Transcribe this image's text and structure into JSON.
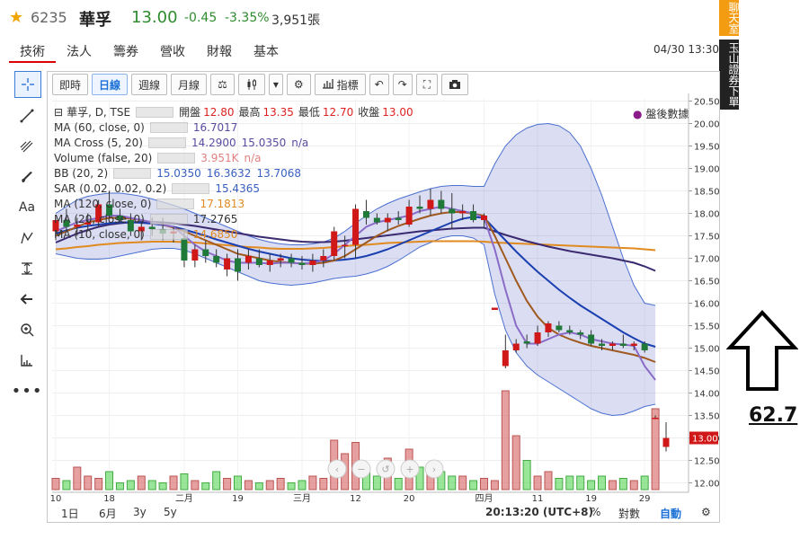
{
  "header": {
    "code": "6235",
    "name": "華孚",
    "price": "13.00",
    "change": "-0.45",
    "change_pct": "-3.35%",
    "volume": "3,951張"
  },
  "tabs": [
    "技術",
    "法人",
    "籌券",
    "營收",
    "財報",
    "基本"
  ],
  "datetime": "04/30 13:30",
  "side": {
    "chat": "聊天室",
    "broker": "玉山證券下單"
  },
  "annotation_value": "62.7",
  "toolbar": [
    "即時",
    "日線",
    "週線",
    "月線"
  ],
  "toolbar_indicator": "指標",
  "legend": {
    "title": "華孚, D, TSE",
    "ohlc": {
      "open_label": "開盤",
      "open": "12.80",
      "high_label": "最高",
      "high": "13.35",
      "low_label": "最低",
      "low": "12.70",
      "close_label": "收盤",
      "close": "13.00"
    },
    "rows": [
      {
        "name": "MA (60, close, 0)",
        "vals": [
          "16.7017"
        ],
        "color": "#5a4aa0"
      },
      {
        "name": "MA Cross (5, 20)",
        "vals": [
          "14.2900",
          "15.0350",
          "n/a"
        ],
        "color": "#5a4aa0"
      },
      {
        "name": "Volume (false, 20)",
        "vals": [
          "3.951K",
          "n/a"
        ],
        "color": "#e08080"
      },
      {
        "name": "BB (20, 2)",
        "vals": [
          "15.0350",
          "16.3632",
          "13.7068"
        ],
        "color": "#3a60c0"
      },
      {
        "name": "SAR (0.02, 0.02, 0.2)",
        "vals": [
          "15.4365"
        ],
        "color": "#3a60c0"
      },
      {
        "name": "MA (120, close, 0)",
        "vals": [
          "17.1813"
        ],
        "color": "#e08a20"
      },
      {
        "name": "MA (20, close, 0)",
        "vals": [
          "17.2765"
        ],
        "color": "#333333"
      },
      {
        "name": "MA (10, close, 0)",
        "vals": [
          "14.6850"
        ],
        "color": "#e08a20"
      }
    ],
    "after_hours": "盤後數據"
  },
  "bottom": {
    "ranges": [
      "1日",
      "6月",
      "3y",
      "5y"
    ],
    "time": "20:13:20 (UTC+8)",
    "pct": "%",
    "log": "對數",
    "auto": "自動"
  },
  "chart_data": {
    "type": "candlestick",
    "title": "華孚, D, TSE",
    "y_ticks": [
      "20.50",
      "20.00",
      "19.50",
      "19.00",
      "18.50",
      "18.00",
      "17.50",
      "17.00",
      "16.50",
      "16.00",
      "15.50",
      "15.00",
      "14.50",
      "14.00",
      "13.50",
      "13.00",
      "12.50",
      "12.00"
    ],
    "ylim": [
      11.85,
      20.55
    ],
    "x_ticks": [
      {
        "label": "10",
        "i": 0
      },
      {
        "label": "18",
        "i": 5
      },
      {
        "label": "二月",
        "i": 12
      },
      {
        "label": "19",
        "i": 17
      },
      {
        "label": "三月",
        "i": 23
      },
      {
        "label": "12",
        "i": 28
      },
      {
        "label": "20",
        "i": 33
      },
      {
        "label": "四月",
        "i": 40
      },
      {
        "label": "11",
        "i": 45
      },
      {
        "label": "19",
        "i": 50
      },
      {
        "label": "29",
        "i": 55
      }
    ],
    "last_price_label": "13.00",
    "candles": [
      {
        "o": 17.6,
        "h": 17.9,
        "l": 17.4,
        "c": 17.85
      },
      {
        "o": 17.85,
        "h": 18.1,
        "l": 17.6,
        "c": 17.7
      },
      {
        "o": 17.7,
        "h": 17.9,
        "l": 17.5,
        "c": 17.75
      },
      {
        "o": 17.75,
        "h": 18.0,
        "l": 17.6,
        "c": 17.8
      },
      {
        "o": 17.8,
        "h": 18.3,
        "l": 17.7,
        "c": 18.2
      },
      {
        "o": 18.2,
        "h": 18.5,
        "l": 17.9,
        "c": 17.95
      },
      {
        "o": 17.95,
        "h": 18.1,
        "l": 17.8,
        "c": 17.85
      },
      {
        "o": 17.85,
        "h": 18.0,
        "l": 17.5,
        "c": 17.6
      },
      {
        "o": 17.6,
        "h": 17.8,
        "l": 17.4,
        "c": 17.7
      },
      {
        "o": 17.7,
        "h": 17.9,
        "l": 17.5,
        "c": 17.65
      },
      {
        "o": 17.65,
        "h": 17.9,
        "l": 17.4,
        "c": 17.55
      },
      {
        "o": 17.55,
        "h": 17.7,
        "l": 17.35,
        "c": 17.6
      },
      {
        "o": 17.45,
        "h": 17.6,
        "l": 16.8,
        "c": 16.95
      },
      {
        "o": 16.95,
        "h": 17.3,
        "l": 16.8,
        "c": 17.2
      },
      {
        "o": 17.2,
        "h": 17.4,
        "l": 16.9,
        "c": 17.05
      },
      {
        "o": 17.05,
        "h": 17.2,
        "l": 16.8,
        "c": 16.9
      },
      {
        "o": 16.75,
        "h": 17.1,
        "l": 16.6,
        "c": 17.0
      },
      {
        "o": 17.0,
        "h": 17.2,
        "l": 16.5,
        "c": 16.7
      },
      {
        "o": 16.9,
        "h": 17.2,
        "l": 16.75,
        "c": 17.05
      },
      {
        "o": 17.0,
        "h": 17.2,
        "l": 16.8,
        "c": 16.85
      },
      {
        "o": 16.85,
        "h": 17.1,
        "l": 16.7,
        "c": 16.95
      },
      {
        "o": 16.95,
        "h": 17.1,
        "l": 16.8,
        "c": 17.0
      },
      {
        "o": 17.0,
        "h": 17.1,
        "l": 16.8,
        "c": 16.9
      },
      {
        "o": 16.9,
        "h": 17.05,
        "l": 16.75,
        "c": 16.85
      },
      {
        "o": 16.85,
        "h": 17.1,
        "l": 16.7,
        "c": 16.95
      },
      {
        "o": 16.95,
        "h": 17.2,
        "l": 16.8,
        "c": 17.05
      },
      {
        "o": 17.05,
        "h": 17.7,
        "l": 16.95,
        "c": 17.6
      },
      {
        "o": 17.3,
        "h": 17.5,
        "l": 17.0,
        "c": 17.3
      },
      {
        "o": 17.3,
        "h": 18.2,
        "l": 17.0,
        "c": 18.1
      },
      {
        "o": 18.05,
        "h": 18.3,
        "l": 17.75,
        "c": 17.9
      },
      {
        "o": 17.9,
        "h": 18.0,
        "l": 17.75,
        "c": 17.8
      },
      {
        "o": 17.8,
        "h": 18.0,
        "l": 17.6,
        "c": 17.9
      },
      {
        "o": 17.9,
        "h": 18.05,
        "l": 17.75,
        "c": 17.85
      },
      {
        "o": 17.75,
        "h": 18.3,
        "l": 17.7,
        "c": 18.15
      },
      {
        "o": 18.15,
        "h": 18.4,
        "l": 18.0,
        "c": 18.1
      },
      {
        "o": 18.1,
        "h": 18.55,
        "l": 17.95,
        "c": 18.3
      },
      {
        "o": 18.3,
        "h": 18.5,
        "l": 18.0,
        "c": 18.1
      },
      {
        "o": 18.1,
        "h": 18.45,
        "l": 17.65,
        "c": 18.0
      },
      {
        "o": 18.0,
        "h": 18.2,
        "l": 17.85,
        "c": 18.05
      },
      {
        "o": 18.05,
        "h": 18.2,
        "l": 17.8,
        "c": 17.85
      },
      {
        "o": 17.85,
        "h": 18.0,
        "l": 17.7,
        "c": 17.95
      },
      {
        "o": 15.85,
        "h": 15.9,
        "l": 15.85,
        "c": 15.9
      },
      {
        "o": 14.6,
        "h": 15.3,
        "l": 14.55,
        "c": 14.95
      },
      {
        "o": 14.95,
        "h": 15.2,
        "l": 14.9,
        "c": 15.1
      },
      {
        "o": 15.15,
        "h": 15.3,
        "l": 15.0,
        "c": 15.1
      },
      {
        "o": 15.1,
        "h": 15.5,
        "l": 15.05,
        "c": 15.35
      },
      {
        "o": 15.35,
        "h": 15.6,
        "l": 15.25,
        "c": 15.55
      },
      {
        "o": 15.5,
        "h": 15.6,
        "l": 15.35,
        "c": 15.4
      },
      {
        "o": 15.4,
        "h": 15.5,
        "l": 15.3,
        "c": 15.35
      },
      {
        "o": 15.35,
        "h": 15.4,
        "l": 15.2,
        "c": 15.3
      },
      {
        "o": 15.3,
        "h": 15.4,
        "l": 15.05,
        "c": 15.1
      },
      {
        "o": 15.1,
        "h": 15.2,
        "l": 14.95,
        "c": 15.05
      },
      {
        "o": 15.05,
        "h": 15.15,
        "l": 14.95,
        "c": 15.1
      },
      {
        "o": 15.1,
        "h": 15.3,
        "l": 15.0,
        "c": 15.05
      },
      {
        "o": 15.05,
        "h": 15.15,
        "l": 14.95,
        "c": 15.1
      },
      {
        "o": 15.1,
        "h": 15.15,
        "l": 14.9,
        "c": 14.95
      },
      {
        "o": 13.45,
        "h": 13.5,
        "l": 13.45,
        "c": 13.45
      },
      {
        "o": 12.8,
        "h": 13.35,
        "l": 12.7,
        "c": 13.0
      }
    ],
    "volumes": [
      0.25,
      0.2,
      0.5,
      0.3,
      0.25,
      0.4,
      0.15,
      0.2,
      0.3,
      0.2,
      0.15,
      0.3,
      0.35,
      0.2,
      0.15,
      0.4,
      0.25,
      0.3,
      0.2,
      0.15,
      0.2,
      0.25,
      0.15,
      0.2,
      0.3,
      0.25,
      1.1,
      0.8,
      1.05,
      0.45,
      0.3,
      0.7,
      0.25,
      0.9,
      0.5,
      0.45,
      0.4,
      0.3,
      0.3,
      0.2,
      0.25,
      0.2,
      2.2,
      1.2,
      0.65,
      0.3,
      0.4,
      0.25,
      0.3,
      0.3,
      0.2,
      0.3,
      0.2,
      0.25,
      0.2,
      0.3,
      1.8
    ],
    "series": [
      {
        "color": "#e08a20",
        "values": [
          17.2,
          17.22,
          17.25,
          17.27,
          17.3,
          17.32,
          17.34,
          17.35,
          17.36,
          17.37,
          17.37,
          17.37,
          17.36,
          17.35,
          17.33,
          17.31,
          17.29,
          17.27,
          17.25,
          17.24,
          17.22,
          17.21,
          17.21,
          17.21,
          17.22,
          17.23,
          17.25,
          17.27,
          17.29,
          17.3,
          17.32,
          17.34,
          17.35,
          17.36,
          17.37,
          17.38,
          17.38,
          17.38,
          17.38,
          17.38,
          17.37,
          17.35,
          17.34,
          17.33,
          17.32,
          17.31,
          17.3,
          17.29,
          17.28,
          17.27,
          17.26,
          17.25,
          17.24,
          17.23,
          17.22,
          17.2,
          17.18
        ]
      },
      {
        "color": "#3a2a70",
        "values": [
          17.35,
          17.45,
          17.55,
          17.63,
          17.7,
          17.75,
          17.78,
          17.8,
          17.81,
          17.81,
          17.8,
          17.78,
          17.75,
          17.72,
          17.68,
          17.64,
          17.6,
          17.56,
          17.52,
          17.48,
          17.45,
          17.42,
          17.39,
          17.37,
          17.36,
          17.36,
          17.37,
          17.39,
          17.42,
          17.45,
          17.48,
          17.51,
          17.54,
          17.57,
          17.6,
          17.62,
          17.64,
          17.66,
          17.67,
          17.68,
          17.68,
          17.6,
          17.52,
          17.45,
          17.38,
          17.32,
          17.26,
          17.21,
          17.16,
          17.12,
          17.08,
          17.04,
          17.0,
          16.95,
          16.9,
          16.82,
          16.72
        ]
      },
      {
        "color": "#1a3fb0",
        "values": [
          17.55,
          17.62,
          17.68,
          17.72,
          17.75,
          17.78,
          17.8,
          17.8,
          17.79,
          17.77,
          17.74,
          17.7,
          17.64,
          17.57,
          17.5,
          17.42,
          17.35,
          17.28,
          17.21,
          17.15,
          17.1,
          17.05,
          17.0,
          16.97,
          16.95,
          16.94,
          16.95,
          16.97,
          17.0,
          17.05,
          17.12,
          17.2,
          17.3,
          17.4,
          17.5,
          17.6,
          17.7,
          17.8,
          17.88,
          17.92,
          17.9,
          17.65,
          17.4,
          17.15,
          16.92,
          16.7,
          16.5,
          16.3,
          16.12,
          15.95,
          15.8,
          15.65,
          15.5,
          15.35,
          15.22,
          15.1,
          15.03
        ]
      },
      {
        "color": "#a05a20",
        "values": [
          17.5,
          17.6,
          17.7,
          17.8,
          17.85,
          17.9,
          17.9,
          17.88,
          17.85,
          17.8,
          17.75,
          17.68,
          17.6,
          17.5,
          17.4,
          17.3,
          17.2,
          17.1,
          17.05,
          17.0,
          16.95,
          16.92,
          16.9,
          16.88,
          16.88,
          16.9,
          16.95,
          17.05,
          17.2,
          17.35,
          17.5,
          17.62,
          17.72,
          17.8,
          17.88,
          17.95,
          18.0,
          18.03,
          18.03,
          17.99,
          17.95,
          17.5,
          17.0,
          16.5,
          16.05,
          15.7,
          15.45,
          15.3,
          15.2,
          15.12,
          15.05,
          15.0,
          14.95,
          14.9,
          14.85,
          14.78,
          14.69
        ]
      },
      {
        "color": "#8a6cc8",
        "values": [
          17.6,
          17.7,
          17.8,
          17.85,
          17.9,
          17.95,
          17.95,
          17.9,
          17.85,
          17.8,
          17.75,
          17.7,
          17.5,
          17.3,
          17.15,
          17.05,
          16.95,
          16.9,
          16.9,
          16.9,
          16.88,
          16.9,
          16.9,
          16.88,
          16.9,
          16.95,
          17.1,
          17.3,
          17.5,
          17.7,
          17.8,
          17.85,
          17.9,
          17.95,
          18.05,
          18.1,
          18.15,
          18.1,
          18.05,
          18.0,
          17.9,
          17.2,
          16.3,
          15.5,
          15.1,
          15.1,
          15.2,
          15.3,
          15.35,
          15.3,
          15.2,
          15.15,
          15.1,
          15.08,
          15.05,
          14.6,
          14.29
        ]
      }
    ],
    "bollinger": {
      "upper": [
        18.0,
        18.15,
        18.3,
        18.38,
        18.42,
        18.45,
        18.45,
        18.42,
        18.38,
        18.32,
        18.25,
        18.18,
        18.1,
        18.0,
        17.9,
        17.8,
        17.7,
        17.6,
        17.5,
        17.42,
        17.36,
        17.32,
        17.3,
        17.3,
        17.32,
        17.36,
        17.45,
        17.6,
        17.78,
        17.95,
        18.1,
        18.22,
        18.32,
        18.4,
        18.48,
        18.55,
        18.6,
        18.62,
        18.62,
        18.6,
        18.6,
        19.1,
        19.5,
        19.75,
        19.9,
        19.98,
        20.0,
        19.95,
        19.8,
        19.5,
        19.0,
        18.4,
        17.7,
        17.0,
        16.4,
        16.0,
        15.95
      ],
      "lower": [
        17.1,
        17.05,
        17.0,
        16.98,
        16.98,
        17.0,
        17.05,
        17.1,
        17.15,
        17.2,
        17.22,
        17.22,
        17.18,
        17.1,
        17.0,
        16.9,
        16.8,
        16.7,
        16.6,
        16.5,
        16.45,
        16.42,
        16.4,
        16.42,
        16.45,
        16.5,
        16.55,
        16.58,
        16.6,
        16.65,
        16.72,
        16.82,
        16.95,
        17.1,
        17.25,
        17.35,
        17.45,
        17.5,
        17.5,
        17.45,
        17.3,
        16.2,
        15.4,
        14.9,
        14.6,
        14.4,
        14.25,
        14.1,
        13.95,
        13.8,
        13.65,
        13.55,
        13.5,
        13.52,
        13.6,
        13.7,
        13.75
      ]
    }
  }
}
